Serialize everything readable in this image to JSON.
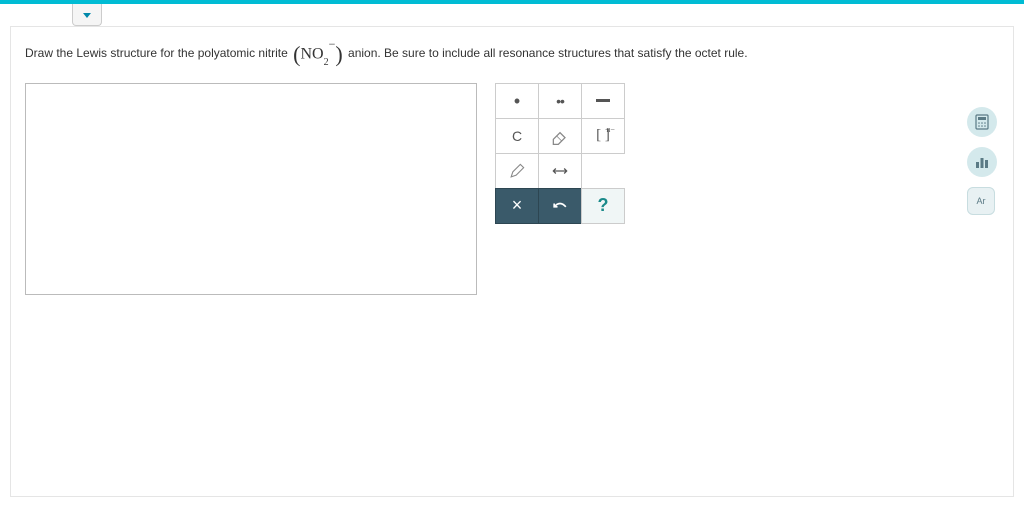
{
  "question": {
    "before": "Draw the Lewis structure for the polyatomic nitrite",
    "formula_base": "NO",
    "formula_sub": "2",
    "formula_sup": "−",
    "after": "anion. Be sure to include all resonance structures that satisfy the octet rule."
  },
  "tools": {
    "single_dot": "•",
    "double_dot": "••",
    "element_c": "C",
    "bracket": "[ ]",
    "bracket_charge": "n−",
    "question_mark": "?",
    "close": "×"
  },
  "side": {
    "periodic_label": "Ar"
  }
}
